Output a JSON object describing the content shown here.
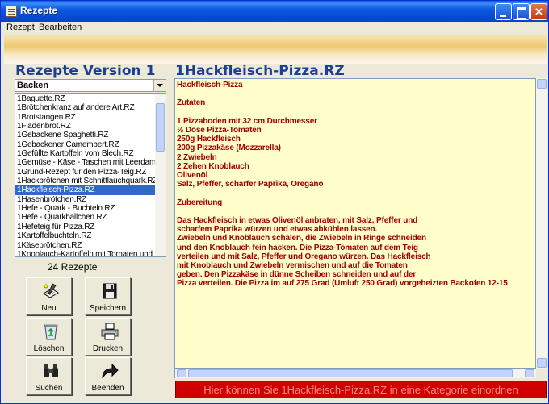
{
  "window": {
    "title": "Rezepte"
  },
  "menu": [
    "Rezept",
    "Bearbeiten"
  ],
  "left": {
    "heading": "Rezepte Version 1",
    "category": "Backen",
    "recipes": [
      "1Baguette.RZ",
      "1Brötchenkranz auf andere Art.RZ",
      "1Brotstangen.RZ",
      "1Fladenbrot.RZ",
      "1Gebackene Spaghetti.RZ",
      "1Gebackener Camembert.RZ",
      "1Gefüllte Kartoffeln vom Blech.RZ",
      "1Gemüse - Käse - Taschen mit Leerdame",
      "1Grund-Rezept für den Pizza-Teig.RZ",
      "1Hackbrötchen mit Schnittlauchquark.RZ",
      "1Hackfleisch-Pizza.RZ",
      "1Hasenbrötchen.RZ",
      "1Hefe - Quark - Buchteln.RZ",
      "1Hefe - Quarkbällchen.RZ",
      "1Hefeteig für Pizza.RZ",
      "1Kartoffelbuchteln.RZ",
      "1Käsebrötchen.RZ",
      "1Knoblauch-Kartoffeln mit Tomaten und S"
    ],
    "selected_index": 10,
    "count_label": "24 Rezepte",
    "buttons": {
      "neu": "Neu",
      "speichern": "Speichern",
      "loeschen": "Löschen",
      "drucken": "Drucken",
      "suchen": "Suchen",
      "beenden": "Beenden"
    }
  },
  "right": {
    "heading": "1Hackfleisch-Pizza.RZ",
    "lines": [
      "Hackfleisch-Pizza",
      "",
      "Zutaten",
      "",
      "1 Pizzaboden mit 32 cm Durchmesser",
      "½ Dose Pizza-Tomaten",
      "250g Hackfleisch",
      "200g Pizzakäse (Mozzarella)",
      "2 Zwiebeln",
      "2 Zehen Knoblauch",
      "Olivenöl",
      "Salz, Pfeffer, scharfer Paprika, Oregano",
      "",
      "Zubereitung",
      "",
      "Das Hackfleisch in etwas Olivenöl anbraten, mit Salz, Pfeffer und",
      "scharfem Paprika würzen und etwas abkühlen lassen.",
      "Zwiebeln und Knoblauch schälen, die Zwiebeln in Ringe schneiden",
      "und den Knoblauch fein hacken. Die Pizza-Tomaten auf dem Teig",
      "verteilen und mit Salz, Pfeffer und Oregano würzen. Das Hackfleisch",
      "mit Knoblauch und Zwiebeln vermischen und auf die Tomaten",
      "geben. Den Pizzakäse in dünne Scheiben schneiden und auf der",
      "Pizza verteilen. Die Pizza im auf 275 Grad (Umluft 250 Grad) vorgeheizten Backofen 12-15"
    ],
    "status": "Hier können Sie 1Hackfleisch-Pizza.RZ in eine Kategorie einordnen"
  }
}
